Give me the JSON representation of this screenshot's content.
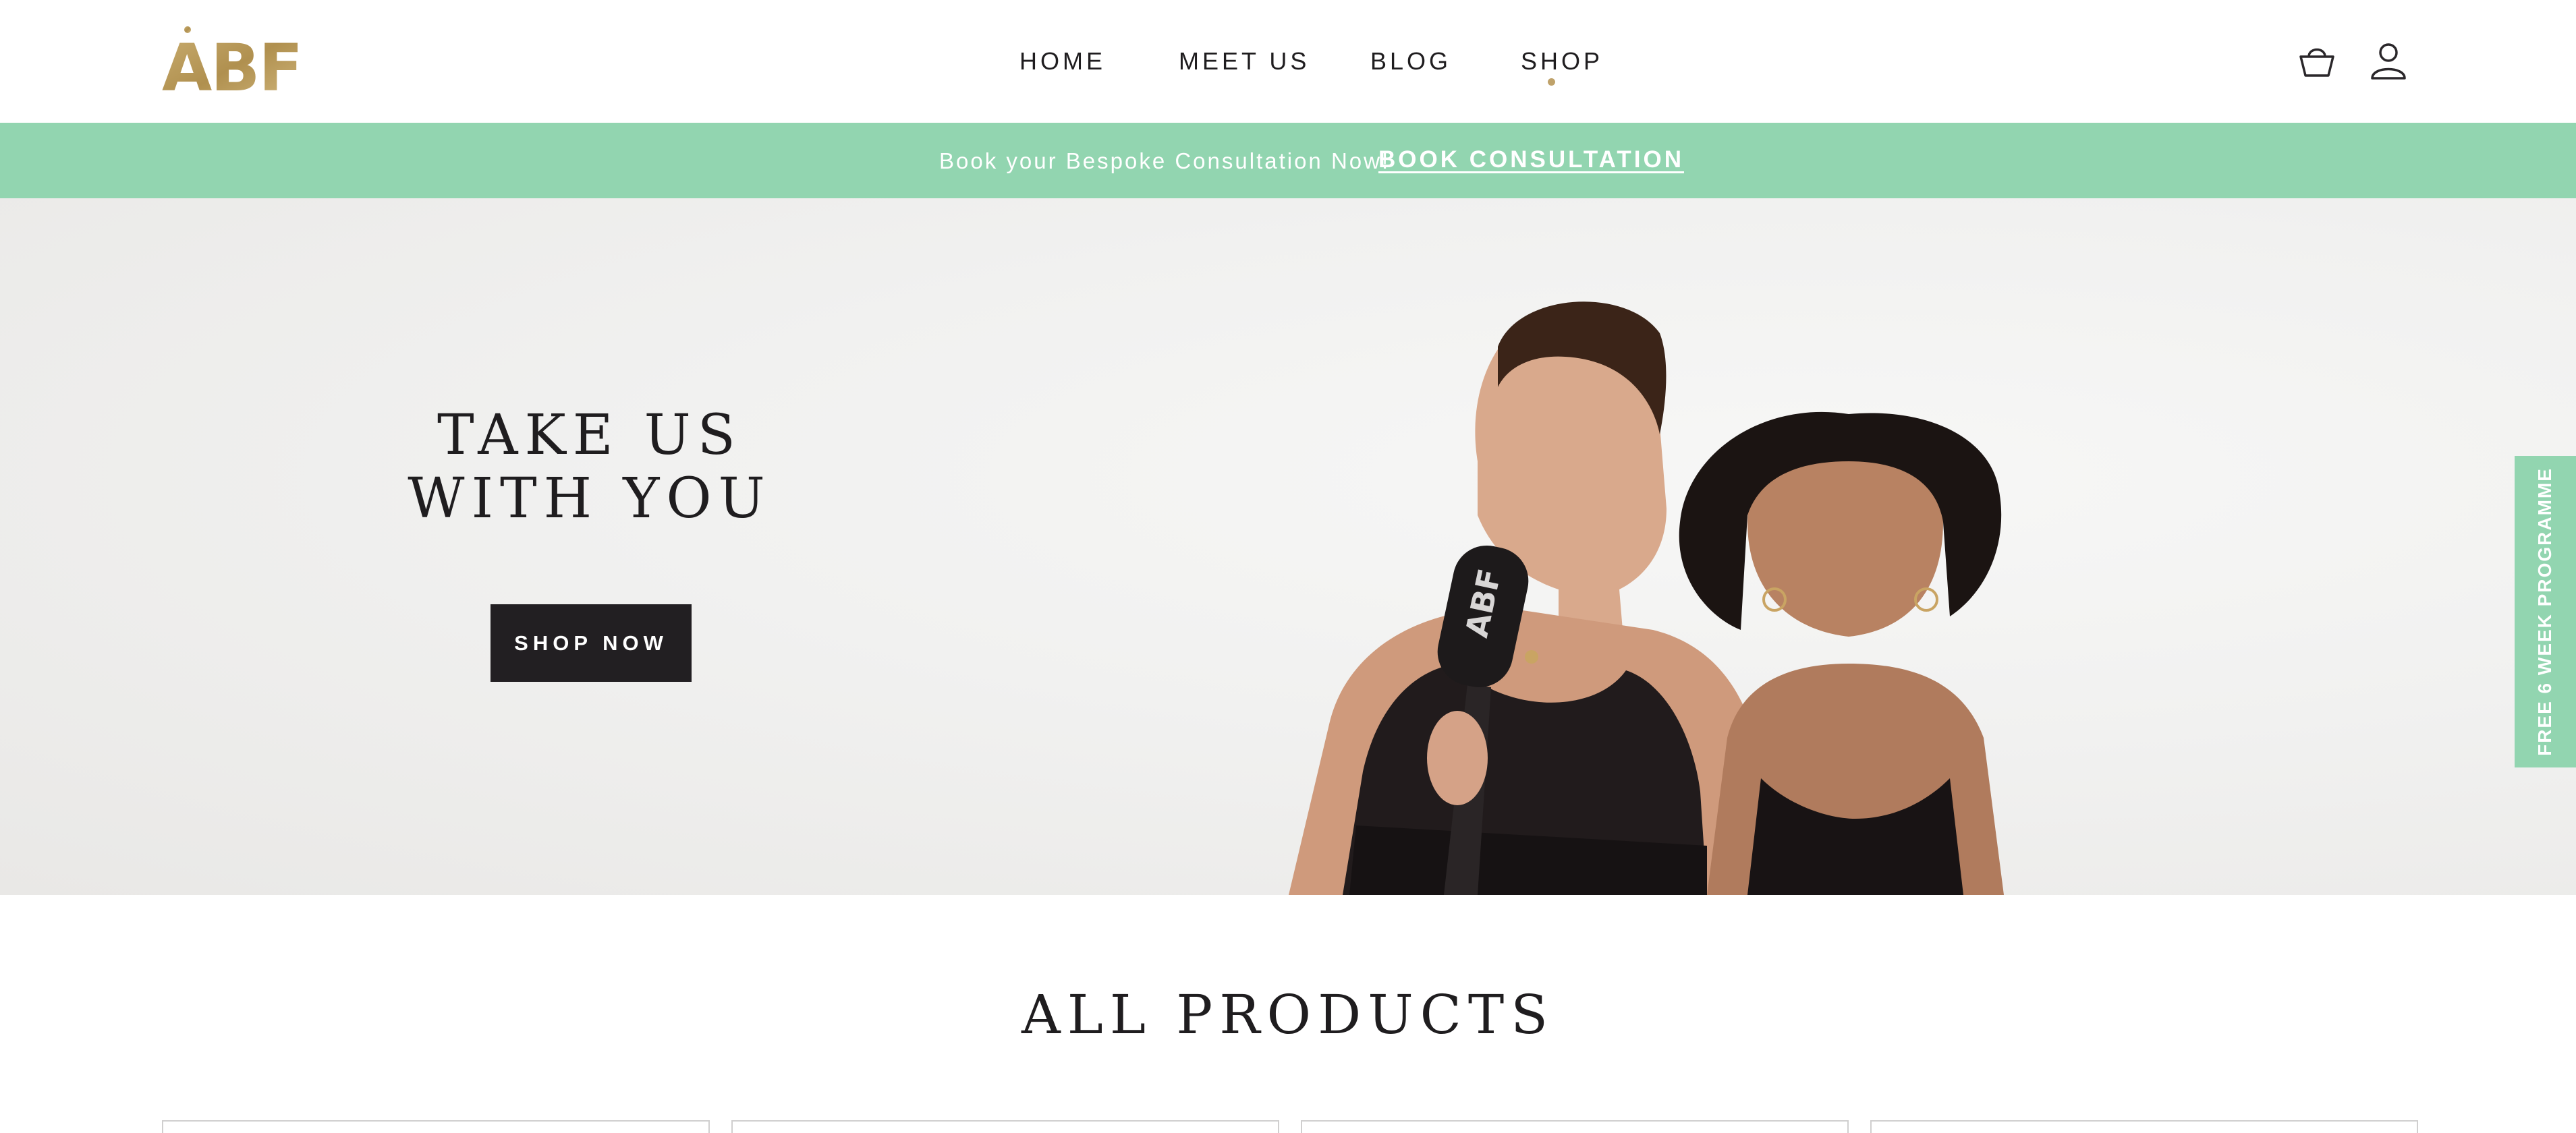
{
  "header": {
    "logo_text": "ABF",
    "nav": [
      {
        "label": "HOME"
      },
      {
        "label": "MEET US"
      },
      {
        "label": "BLOG"
      },
      {
        "label": "SHOP",
        "active": true
      }
    ],
    "icons": [
      "basket-icon",
      "user-icon"
    ]
  },
  "banner": {
    "text": "Book your Bespoke Consultation Now!",
    "link_label": "BOOK CONSULTATION"
  },
  "hero": {
    "title_line1": "TAKE US",
    "title_line2": "WITH YOU",
    "button_label": "SHOP NOW",
    "microphone_logo": "ABF"
  },
  "side_tab": {
    "label": "FREE 6 WEEK PROGRAMME"
  },
  "products": {
    "title": "ALL PRODUCTS"
  },
  "colors": {
    "accent_gold": "#bfa26a",
    "banner_green": "#92d5b0",
    "button_dark": "#221f22"
  }
}
